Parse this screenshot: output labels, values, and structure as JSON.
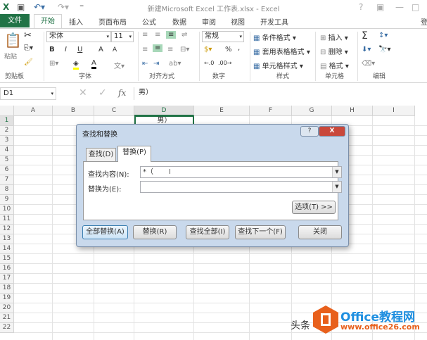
{
  "titlebar": {
    "title": "新建Microsoft Excel 工作表.xlsx - Excel",
    "help": "?",
    "minimize": "—",
    "restore": "□"
  },
  "tabs": {
    "file": "文件",
    "home": "开始",
    "insert": "插入",
    "layout": "页面布局",
    "formulas": "公式",
    "data": "数据",
    "review": "审阅",
    "view": "视图",
    "developer": "开发工具",
    "login": "登"
  },
  "ribbon": {
    "clipboard": {
      "paste": "粘贴",
      "group": "剪贴板"
    },
    "font": {
      "name": "宋体",
      "size": "11",
      "bold": "B",
      "italic": "I",
      "underline": "U",
      "grow": "A",
      "shrink": "A",
      "group": "字体"
    },
    "alignment": {
      "group": "对齐方式"
    },
    "number": {
      "format": "常规",
      "percent": "%",
      "comma": ",",
      "group": "数字"
    },
    "styles": {
      "conditional": "条件格式",
      "table": "套用表格格式",
      "cell": "单元格样式",
      "group": "样式"
    },
    "cells": {
      "insert": "插入",
      "delete": "删除",
      "format": "格式",
      "group": "单元格"
    },
    "editing": {
      "sum": "Σ",
      "group": "编辑"
    }
  },
  "formula_bar": {
    "name_box": "D1",
    "fx": "fx",
    "value": "男）"
  },
  "grid": {
    "columns": [
      "A",
      "B",
      "C",
      "D",
      "E",
      "F",
      "G",
      "H",
      "I"
    ],
    "rows": [
      "1",
      "2",
      "3",
      "4",
      "5",
      "6",
      "7",
      "8",
      "9",
      "10",
      "11",
      "12",
      "13",
      "14",
      "15",
      "16",
      "17",
      "18",
      "19",
      "20",
      "21",
      "22"
    ],
    "d1_value": "男）"
  },
  "dialog": {
    "title": "查找和替换",
    "help": "?",
    "close": "X",
    "tab_find": "查找(D)",
    "tab_replace": "替换(P)",
    "find_label": "查找内容(N):",
    "find_value": "*（",
    "replace_label": "替换为(E):",
    "replace_value": "",
    "options": "选项(T) >>",
    "replace_all": "全部替换(A)",
    "replace": "替换(R)",
    "find_all": "查找全部(I)",
    "find_next": "查找下一个(F)",
    "close_btn": "关闭"
  },
  "watermark": {
    "text1": "头条",
    "brand": "Office教程网",
    "url": "www.office26.com"
  }
}
